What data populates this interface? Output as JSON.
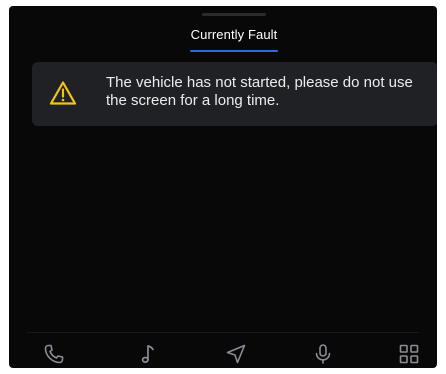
{
  "tabs": [
    {
      "label": "Currently Fault",
      "active": true
    }
  ],
  "alert": {
    "icon": "warning-icon",
    "message": "The vehicle has not started, please do not use the screen for a long time.",
    "accent_color": "#f2c418"
  },
  "bottom_nav": [
    {
      "icon": "phone-icon"
    },
    {
      "icon": "music-icon"
    },
    {
      "icon": "navigation-icon"
    },
    {
      "icon": "microphone-icon"
    },
    {
      "icon": "apps-grid-icon"
    }
  ],
  "colors": {
    "screen_background": "#080809",
    "card_background": "#202124",
    "tab_underline": "#2a6bd6",
    "icon_color": "#8a8d93"
  }
}
